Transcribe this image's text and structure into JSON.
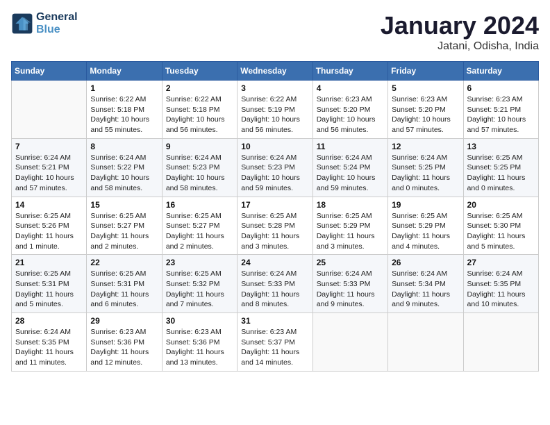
{
  "header": {
    "logo_line1": "General",
    "logo_line2": "Blue",
    "month_title": "January 2024",
    "location": "Jatani, Odisha, India"
  },
  "days_of_week": [
    "Sunday",
    "Monday",
    "Tuesday",
    "Wednesday",
    "Thursday",
    "Friday",
    "Saturday"
  ],
  "weeks": [
    [
      {
        "num": "",
        "info": ""
      },
      {
        "num": "1",
        "info": "Sunrise: 6:22 AM\nSunset: 5:18 PM\nDaylight: 10 hours\nand 55 minutes."
      },
      {
        "num": "2",
        "info": "Sunrise: 6:22 AM\nSunset: 5:18 PM\nDaylight: 10 hours\nand 56 minutes."
      },
      {
        "num": "3",
        "info": "Sunrise: 6:22 AM\nSunset: 5:19 PM\nDaylight: 10 hours\nand 56 minutes."
      },
      {
        "num": "4",
        "info": "Sunrise: 6:23 AM\nSunset: 5:20 PM\nDaylight: 10 hours\nand 56 minutes."
      },
      {
        "num": "5",
        "info": "Sunrise: 6:23 AM\nSunset: 5:20 PM\nDaylight: 10 hours\nand 57 minutes."
      },
      {
        "num": "6",
        "info": "Sunrise: 6:23 AM\nSunset: 5:21 PM\nDaylight: 10 hours\nand 57 minutes."
      }
    ],
    [
      {
        "num": "7",
        "info": "Sunrise: 6:24 AM\nSunset: 5:21 PM\nDaylight: 10 hours\nand 57 minutes."
      },
      {
        "num": "8",
        "info": "Sunrise: 6:24 AM\nSunset: 5:22 PM\nDaylight: 10 hours\nand 58 minutes."
      },
      {
        "num": "9",
        "info": "Sunrise: 6:24 AM\nSunset: 5:23 PM\nDaylight: 10 hours\nand 58 minutes."
      },
      {
        "num": "10",
        "info": "Sunrise: 6:24 AM\nSunset: 5:23 PM\nDaylight: 10 hours\nand 59 minutes."
      },
      {
        "num": "11",
        "info": "Sunrise: 6:24 AM\nSunset: 5:24 PM\nDaylight: 10 hours\nand 59 minutes."
      },
      {
        "num": "12",
        "info": "Sunrise: 6:24 AM\nSunset: 5:25 PM\nDaylight: 11 hours\nand 0 minutes."
      },
      {
        "num": "13",
        "info": "Sunrise: 6:25 AM\nSunset: 5:25 PM\nDaylight: 11 hours\nand 0 minutes."
      }
    ],
    [
      {
        "num": "14",
        "info": "Sunrise: 6:25 AM\nSunset: 5:26 PM\nDaylight: 11 hours\nand 1 minute."
      },
      {
        "num": "15",
        "info": "Sunrise: 6:25 AM\nSunset: 5:27 PM\nDaylight: 11 hours\nand 2 minutes."
      },
      {
        "num": "16",
        "info": "Sunrise: 6:25 AM\nSunset: 5:27 PM\nDaylight: 11 hours\nand 2 minutes."
      },
      {
        "num": "17",
        "info": "Sunrise: 6:25 AM\nSunset: 5:28 PM\nDaylight: 11 hours\nand 3 minutes."
      },
      {
        "num": "18",
        "info": "Sunrise: 6:25 AM\nSunset: 5:29 PM\nDaylight: 11 hours\nand 3 minutes."
      },
      {
        "num": "19",
        "info": "Sunrise: 6:25 AM\nSunset: 5:29 PM\nDaylight: 11 hours\nand 4 minutes."
      },
      {
        "num": "20",
        "info": "Sunrise: 6:25 AM\nSunset: 5:30 PM\nDaylight: 11 hours\nand 5 minutes."
      }
    ],
    [
      {
        "num": "21",
        "info": "Sunrise: 6:25 AM\nSunset: 5:31 PM\nDaylight: 11 hours\nand 5 minutes."
      },
      {
        "num": "22",
        "info": "Sunrise: 6:25 AM\nSunset: 5:31 PM\nDaylight: 11 hours\nand 6 minutes."
      },
      {
        "num": "23",
        "info": "Sunrise: 6:25 AM\nSunset: 5:32 PM\nDaylight: 11 hours\nand 7 minutes."
      },
      {
        "num": "24",
        "info": "Sunrise: 6:24 AM\nSunset: 5:33 PM\nDaylight: 11 hours\nand 8 minutes."
      },
      {
        "num": "25",
        "info": "Sunrise: 6:24 AM\nSunset: 5:33 PM\nDaylight: 11 hours\nand 9 minutes."
      },
      {
        "num": "26",
        "info": "Sunrise: 6:24 AM\nSunset: 5:34 PM\nDaylight: 11 hours\nand 9 minutes."
      },
      {
        "num": "27",
        "info": "Sunrise: 6:24 AM\nSunset: 5:35 PM\nDaylight: 11 hours\nand 10 minutes."
      }
    ],
    [
      {
        "num": "28",
        "info": "Sunrise: 6:24 AM\nSunset: 5:35 PM\nDaylight: 11 hours\nand 11 minutes."
      },
      {
        "num": "29",
        "info": "Sunrise: 6:23 AM\nSunset: 5:36 PM\nDaylight: 11 hours\nand 12 minutes."
      },
      {
        "num": "30",
        "info": "Sunrise: 6:23 AM\nSunset: 5:36 PM\nDaylight: 11 hours\nand 13 minutes."
      },
      {
        "num": "31",
        "info": "Sunrise: 6:23 AM\nSunset: 5:37 PM\nDaylight: 11 hours\nand 14 minutes."
      },
      {
        "num": "",
        "info": ""
      },
      {
        "num": "",
        "info": ""
      },
      {
        "num": "",
        "info": ""
      }
    ]
  ]
}
